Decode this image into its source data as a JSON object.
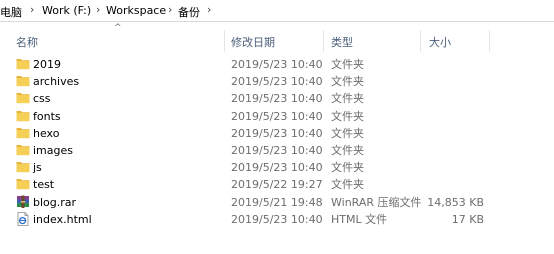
{
  "breadcrumb": {
    "items": [
      "电脑",
      "Work (F:)",
      "Workspace",
      "备份"
    ],
    "separator_icon": "chevron-right-icon"
  },
  "columns": {
    "name": "名称",
    "date": "修改日期",
    "type": "类型",
    "size": "大小",
    "sort_icon": "sort-ascending-caret-icon"
  },
  "files": [
    {
      "name": "2019",
      "date": "2019/5/23 10:40",
      "type": "文件夹",
      "size": "",
      "icon": "folder-icon"
    },
    {
      "name": "archives",
      "date": "2019/5/23 10:40",
      "type": "文件夹",
      "size": "",
      "icon": "folder-icon"
    },
    {
      "name": "css",
      "date": "2019/5/23 10:40",
      "type": "文件夹",
      "size": "",
      "icon": "folder-icon"
    },
    {
      "name": "fonts",
      "date": "2019/5/23 10:40",
      "type": "文件夹",
      "size": "",
      "icon": "folder-icon"
    },
    {
      "name": "hexo",
      "date": "2019/5/23 10:40",
      "type": "文件夹",
      "size": "",
      "icon": "folder-icon"
    },
    {
      "name": "images",
      "date": "2019/5/23 10:40",
      "type": "文件夹",
      "size": "",
      "icon": "folder-icon"
    },
    {
      "name": "js",
      "date": "2019/5/23 10:40",
      "type": "文件夹",
      "size": "",
      "icon": "folder-icon"
    },
    {
      "name": "test",
      "date": "2019/5/22 19:27",
      "type": "文件夹",
      "size": "",
      "icon": "folder-icon"
    },
    {
      "name": "blog.rar",
      "date": "2019/5/21 19:48",
      "type": "WinRAR 压缩文件",
      "size": "14,853 KB",
      "icon": "winrar-archive-icon"
    },
    {
      "name": "index.html",
      "date": "2019/5/23 10:40",
      "type": "HTML 文件",
      "size": "17 KB",
      "icon": "html-file-icon"
    }
  ],
  "colors": {
    "folder": "#f6cf57",
    "folder_tab": "#e8b33a",
    "header_text": "#4c607a",
    "secondary_text": "#6d6d6d"
  }
}
